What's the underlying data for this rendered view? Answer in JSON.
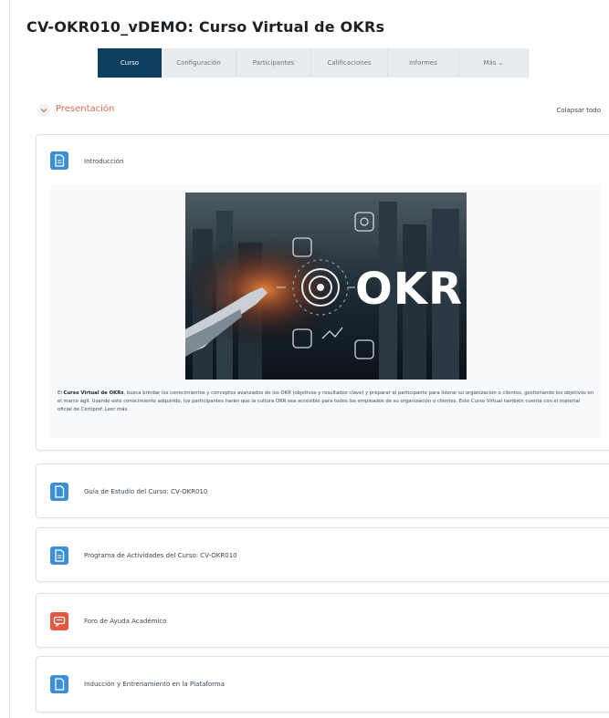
{
  "page": {
    "title": "CV-OKR010_vDEMO: Curso Virtual de OKRs"
  },
  "tabs": [
    {
      "label": "Curso",
      "active": true
    },
    {
      "label": "Configuración"
    },
    {
      "label": "Participantes"
    },
    {
      "label": "Calificaciones"
    },
    {
      "label": "Informes"
    },
    {
      "label": "Más ⌄"
    }
  ],
  "section": {
    "title": "Presentación",
    "collapse_all": "Colapsar todo"
  },
  "intro": {
    "name": "Introducción",
    "image_text": "OKR",
    "summary_bold": "Curso Virtual de OKRs",
    "summary_prefix": "El",
    "summary_rest": ", busca brindar los conocimientos y conceptos avanzados de los OKR (objetivos y resultados clave) y preparar al participante para liderar su organización o clientes, gestionando los objetivos en el marco ágil. Usando este conocimiento adquirido, los participantes harán que la cultura OKR sea accesible para todos los empleados de su organización o clientes. Este Curso Virtual también cuenta con el material oficial de Certiprof. Leer más."
  },
  "activities": [
    {
      "name": "Guía de Estudio del Curso: CV-OKR010",
      "icon": "document-icon",
      "color": "#3a8fd6"
    },
    {
      "name": "Programa de Actividades del Curso: CV-OKR010",
      "icon": "document-lines-icon",
      "color": "#3a8fd6"
    },
    {
      "name": "Foro de Ayuda Académico",
      "icon": "forum-icon",
      "color": "#e5573f"
    },
    {
      "name": "Inducción y Entrenamiento en la Plataforma",
      "icon": "document-icon",
      "color": "#3a8fd6"
    }
  ]
}
